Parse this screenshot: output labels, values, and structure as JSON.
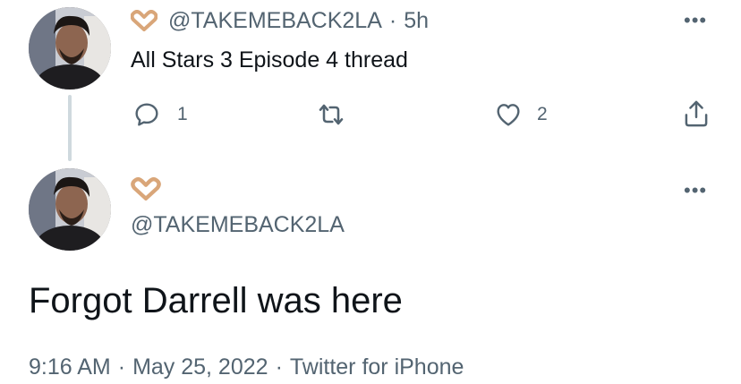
{
  "tweet1": {
    "handle": "@TAKEMEBACK2LA",
    "separator": "·",
    "time": "5h",
    "text": "All Stars 3 Episode 4 thread",
    "reply_count": "1",
    "like_count": "2",
    "more": "•••"
  },
  "tweet2": {
    "handle": "@TAKEMEBACK2LA",
    "more": "•••",
    "text": "Forgot Darrell was here",
    "meta": {
      "time": "9:16 AM",
      "sep1": "·",
      "date": "May 25, 2022",
      "sep2": "·",
      "source": "Twitter for iPhone"
    }
  },
  "colors": {
    "muted": "#536471",
    "text": "#0f1419",
    "heart_emoji": "#d9a679",
    "thread_line": "#cfd9de"
  },
  "icons": [
    "heart-hands-emoji",
    "reply-icon",
    "retweet-icon",
    "like-icon",
    "share-icon",
    "more-icon"
  ]
}
